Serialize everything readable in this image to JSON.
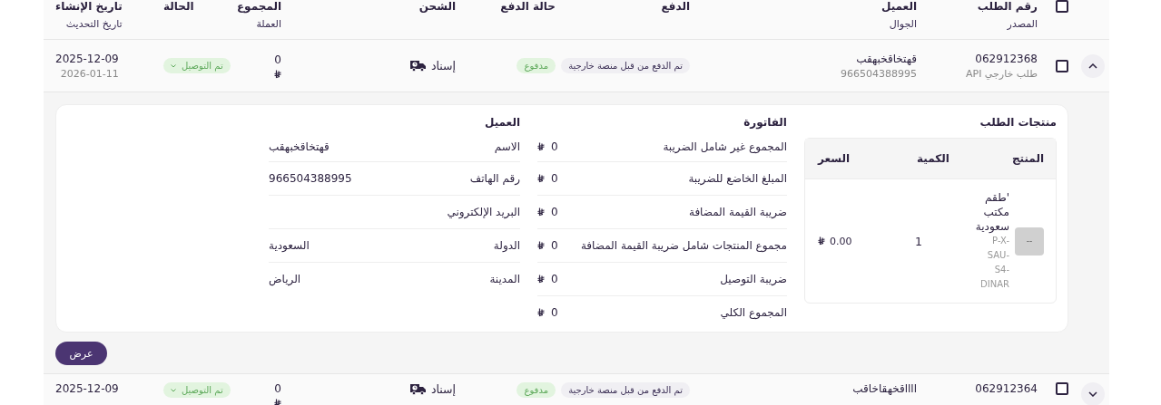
{
  "header": {
    "checked": false,
    "columns": [
      {
        "kind": "order",
        "label": "رقم الطلب",
        "sublabel": "المصدر"
      },
      {
        "kind": "customer",
        "label": "العميل",
        "sublabel": "الجوال"
      },
      {
        "kind": "payment",
        "label": "الدفع"
      },
      {
        "kind": "paystatus",
        "label": "حالة الدفع"
      },
      {
        "kind": "shipping",
        "label": "الشحن"
      },
      {
        "kind": "total",
        "label": "المجموع",
        "sublabel": "العملة"
      },
      {
        "kind": "status",
        "label": "الحالة"
      },
      {
        "kind": "dates",
        "label": "تاريخ الإنشاء",
        "sublabel": "تاريخ التحديث"
      }
    ]
  },
  "orders": [
    {
      "expanded": true,
      "checked": false,
      "order_number": "062912368",
      "source": "طلب خارجي API",
      "customer_name": "قهتخاقخبهقب",
      "phone": "966504388995",
      "payment": "تم الدفع من قبل منصة خارجية",
      "payment_status": "مدفوع",
      "shipping": "إسناد",
      "total": "0",
      "status": "تم التوصيل",
      "created": "2025-12-09",
      "updated": "2026-01-11",
      "details": {
        "products_title": "منتجات الطلب",
        "product_columns": [
          "المنتج",
          "الكمية",
          "السعر"
        ],
        "products": [
          {
            "image_label": "--",
            "name": "'طقم مكتب سعودية",
            "sku": "P-X-SAU-S4-DINAR",
            "quantity": "1",
            "price": "0.00"
          }
        ],
        "invoice_title": "الفاتورة",
        "invoice_rows": [
          {
            "label": "المجموع غير شامل الضريبة",
            "value": "0"
          },
          {
            "label": "المبلغ الخاضع للضريبة",
            "value": "0"
          },
          {
            "label": "ضريبة القيمة المضافة",
            "value": "0"
          },
          {
            "label": "مجموع المنتجات شامل ضريبة القيمة المضافة",
            "value": "0"
          },
          {
            "label": "ضريبة التوصيل",
            "value": "0"
          },
          {
            "label": "المجموع الكلي",
            "value": "0"
          }
        ],
        "customer_title": "العميل",
        "customer_rows": [
          {
            "label": "الاسم",
            "value": "قهتخاقخبهقب"
          },
          {
            "label": "رقم الهاتف",
            "value": "966504388995"
          },
          {
            "label": "البريد الإلكتروني"
          },
          {
            "label": "الدولة",
            "value": "السعودية"
          },
          {
            "label": "المدينة",
            "value": "الرياض"
          }
        ],
        "view_button": "عرض"
      }
    },
    {
      "expanded": false,
      "checked": false,
      "order_number": "062912364",
      "customer_name": "ااااقخهقاخاقب",
      "payment": "تم الدفع من قبل منصة خارجية",
      "payment_status": "مدفوع",
      "shipping": "إسناد",
      "total": "0",
      "status": "تم التوصيل",
      "created": "2025-12-09"
    }
  ]
}
